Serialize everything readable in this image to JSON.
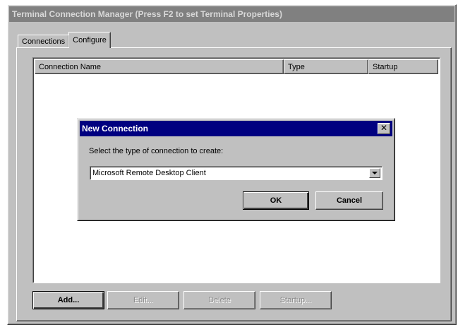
{
  "window": {
    "title": "Terminal Connection Manager (Press F2 to set Terminal Properties)"
  },
  "tabs": [
    {
      "label": "Connections",
      "active": false
    },
    {
      "label": "Configure",
      "active": true
    }
  ],
  "list": {
    "columns": [
      "Connection Name",
      "Type",
      "Startup"
    ],
    "rows": []
  },
  "buttons": {
    "add": "Add...",
    "edit": "Edit...",
    "delete": "Delete",
    "startup": "Startup..."
  },
  "dialog": {
    "title": "New Connection",
    "close_icon": "close-icon",
    "prompt": "Select the type of connection to create:",
    "selected_type": "Microsoft Remote Desktop Client",
    "ok": "OK",
    "cancel": "Cancel"
  },
  "colors": {
    "dialog_title_bg": "#000080",
    "window_title_bg": "#808080",
    "face": "#c0c0c0"
  }
}
